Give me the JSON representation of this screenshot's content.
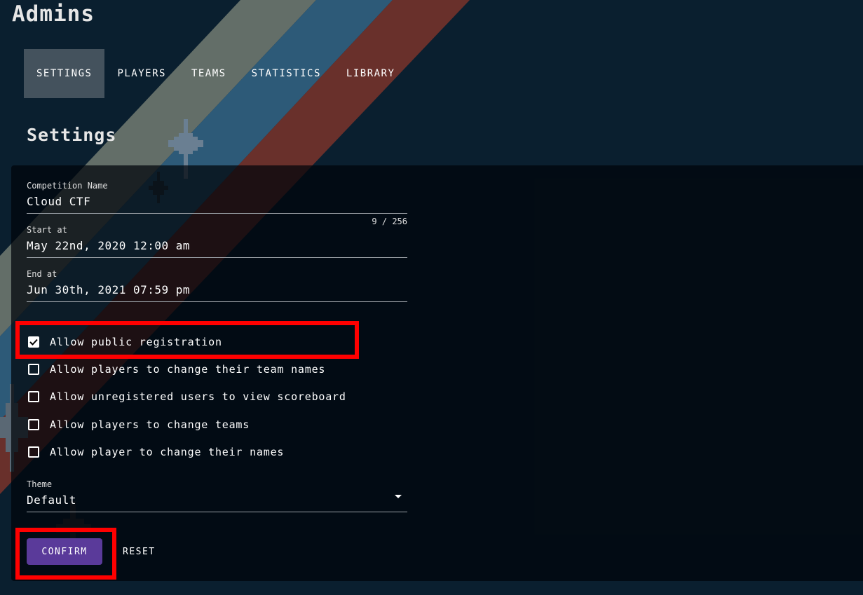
{
  "page": {
    "title": "Admins",
    "section_title": "Settings"
  },
  "tabs": [
    {
      "label": "SETTINGS",
      "active": true
    },
    {
      "label": "PLAYERS",
      "active": false
    },
    {
      "label": "TEAMS",
      "active": false
    },
    {
      "label": "STATISTICS",
      "active": false
    },
    {
      "label": "LIBRARY",
      "active": false
    }
  ],
  "form": {
    "competition_name": {
      "label": "Competition Name",
      "value": "Cloud CTF",
      "counter": "9 / 256"
    },
    "start_at": {
      "label": "Start at",
      "value": "May 22nd, 2020 12:00 am"
    },
    "end_at": {
      "label": "End at",
      "value": "Jun 30th, 2021 07:59 pm"
    },
    "options": [
      {
        "label": "Allow public registration",
        "checked": true
      },
      {
        "label": "Allow players to change their team names",
        "checked": false
      },
      {
        "label": "Allow unregistered users to view scoreboard",
        "checked": false
      },
      {
        "label": "Allow players to change teams",
        "checked": false
      },
      {
        "label": "Allow player to change their names",
        "checked": false
      }
    ],
    "theme": {
      "label": "Theme",
      "value": "Default"
    }
  },
  "buttons": {
    "confirm": "CONFIRM",
    "reset": "RESET"
  },
  "colors": {
    "background": "#0a1f2f",
    "stripe_gray": "#636e68",
    "stripe_blue": "#2d5a78",
    "stripe_red": "#69302b",
    "accent": "#5a3a9a",
    "highlight": "#ff0000"
  }
}
